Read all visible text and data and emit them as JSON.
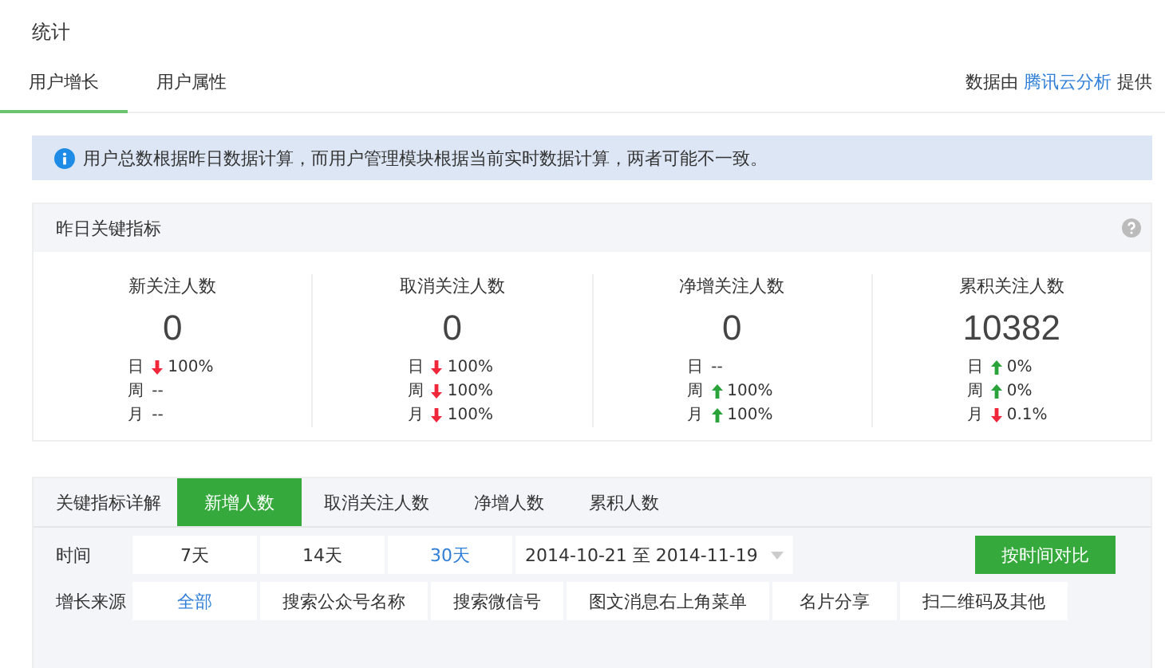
{
  "title": "统计",
  "tabs": [
    {
      "label": "用户增长",
      "selected": true
    },
    {
      "label": "用户属性",
      "selected": false
    }
  ],
  "provider": {
    "before": "数据由",
    "link": "腾讯云分析",
    "after": "提供"
  },
  "notice": "用户总数根据昨日数据计算，而用户管理模块根据当前实时数据计算，两者可能不一致。",
  "key_metrics": {
    "title": "昨日关键指标",
    "metrics": [
      {
        "name": "新关注人数",
        "value": "0",
        "changes": [
          {
            "period": "日",
            "kind": "down",
            "value": "100%"
          },
          {
            "period": "周",
            "kind": "flat",
            "value": "--"
          },
          {
            "period": "月",
            "kind": "flat",
            "value": "--"
          }
        ]
      },
      {
        "name": "取消关注人数",
        "value": "0",
        "changes": [
          {
            "period": "日",
            "kind": "down",
            "value": "100%"
          },
          {
            "period": "周",
            "kind": "down",
            "value": "100%"
          },
          {
            "period": "月",
            "kind": "down",
            "value": "100%"
          }
        ]
      },
      {
        "name": "净增关注人数",
        "value": "0",
        "changes": [
          {
            "period": "日",
            "kind": "flat",
            "value": "--"
          },
          {
            "period": "周",
            "kind": "up",
            "value": "100%"
          },
          {
            "period": "月",
            "kind": "up",
            "value": "100%"
          }
        ]
      },
      {
        "name": "累积关注人数",
        "value": "10382",
        "changes": [
          {
            "period": "日",
            "kind": "up",
            "value": "0%"
          },
          {
            "period": "周",
            "kind": "up",
            "value": "0%"
          },
          {
            "period": "月",
            "kind": "down",
            "value": "0.1%"
          }
        ]
      }
    ]
  },
  "detail": {
    "title": "关键指标详解",
    "tabs": [
      {
        "label": "新增人数",
        "selected": true
      },
      {
        "label": "取消关注人数",
        "selected": false
      },
      {
        "label": "净增人数",
        "selected": false
      },
      {
        "label": "累积人数",
        "selected": false
      }
    ],
    "time_label": "时间",
    "time_options": [
      {
        "label": "7天",
        "selected": false
      },
      {
        "label": "14天",
        "selected": false
      },
      {
        "label": "30天",
        "selected": true
      }
    ],
    "date_range": "2014-10-21 至 2014-11-19",
    "compare_button": "按时间对比",
    "source_label": "增长来源",
    "source_options": [
      {
        "label": "全部",
        "selected": true
      },
      {
        "label": "搜索公众号名称",
        "selected": false
      },
      {
        "label": "搜索微信号",
        "selected": false
      },
      {
        "label": "图文消息右上角菜单",
        "selected": false
      },
      {
        "label": "名片分享",
        "selected": false
      },
      {
        "label": "扫二维码及其他",
        "selected": false
      }
    ]
  }
}
